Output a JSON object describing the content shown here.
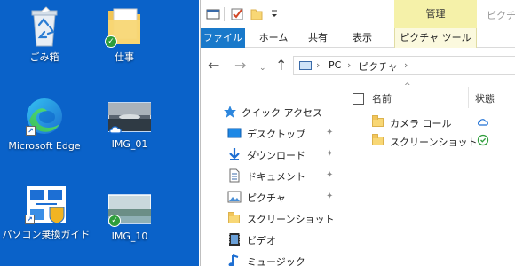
{
  "desktop": {
    "background": "#0a62c9",
    "icons": [
      {
        "label": "ごみ箱",
        "icon": "recycle-bin-icon"
      },
      {
        "label": "仕事",
        "icon": "folder-icon",
        "status": "synced-check"
      },
      {
        "label": "Microsoft Edge",
        "icon": "edge-icon",
        "shortcut": true
      },
      {
        "label": "IMG_01",
        "icon": "photo-thumbnail",
        "status": "cloud"
      },
      {
        "label": "パソコン乗換ガイド",
        "icon": "pc-transfer-guide-icon",
        "shortcut": true
      },
      {
        "label": "IMG_10",
        "icon": "photo-thumbnail",
        "status": "synced-check"
      }
    ]
  },
  "explorer": {
    "titlebar": {
      "manage_tab": "管理",
      "title_fragment": "ピクチャ",
      "quick_access_icons": [
        "properties-icon",
        "checkmark-icon",
        "new-folder-icon",
        "customize-dropdown-icon"
      ]
    },
    "ribbon": {
      "tabs": [
        "ファイル",
        "ホーム",
        "共有",
        "表示",
        "ピクチャ ツール"
      ],
      "file_color": "#1979ca",
      "manage_color": "#f5f1a9"
    },
    "address": {
      "crumbs": [
        "PC",
        "ピクチャ"
      ],
      "separator": "›"
    },
    "nav_pane": {
      "quick_access": "クイック アクセス",
      "items": [
        {
          "label": "デスクトップ",
          "icon": "desktop-icon",
          "pinned": true
        },
        {
          "label": "ダウンロード",
          "icon": "download-icon",
          "pinned": true
        },
        {
          "label": "ドキュメント",
          "icon": "document-icon",
          "pinned": true
        },
        {
          "label": "ピクチャ",
          "icon": "pictures-icon",
          "pinned": true
        },
        {
          "label": "スクリーンショット",
          "icon": "folder-icon",
          "pinned": false
        },
        {
          "label": "ビデオ",
          "icon": "video-icon",
          "pinned": false
        },
        {
          "label": "ミュージック",
          "icon": "music-icon",
          "pinned": false
        }
      ]
    },
    "content": {
      "col_name": "名前",
      "col_status": "状態",
      "sort_indicator": "^",
      "rows": [
        {
          "name": "カメラ ロール",
          "status": "cloud"
        },
        {
          "name": "スクリーンショット",
          "status": "synced-check"
        }
      ]
    }
  },
  "glyphs": {
    "back": "←",
    "forward": "→",
    "recent": "⌄",
    "up": "↑",
    "pin": "📌",
    "check": "✓",
    "arrow": "↗"
  }
}
